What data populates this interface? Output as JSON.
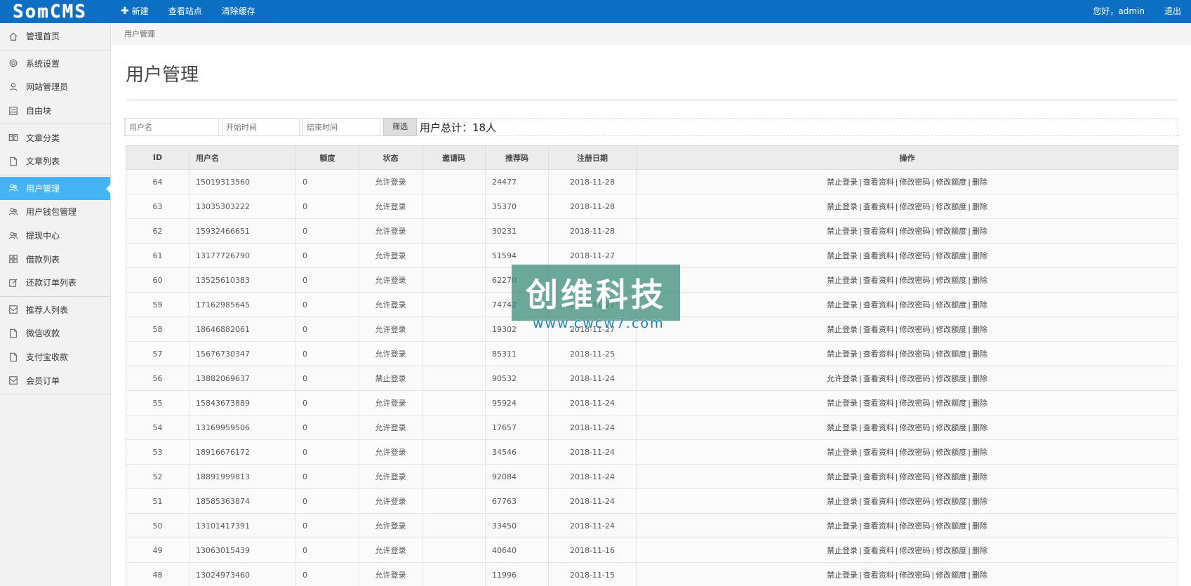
{
  "app": {
    "logo": "SomCMS"
  },
  "topnav": {
    "new_label": "新建",
    "view_site_label": "查看站点",
    "clear_cache_label": "清除缓存",
    "greeting": "您好，admin",
    "logout_label": "退出"
  },
  "sidebar": {
    "groups": [
      [
        {
          "label": "管理首页",
          "icon": "home-icon"
        }
      ],
      [
        {
          "label": "系统设置",
          "icon": "gear-icon"
        },
        {
          "label": "网站管理员",
          "icon": "user-icon"
        },
        {
          "label": "自由块",
          "icon": "block-icon"
        }
      ],
      [
        {
          "label": "文章分类",
          "icon": "book-icon"
        },
        {
          "label": "文章列表",
          "icon": "file-icon"
        }
      ],
      [
        {
          "label": "用户管理",
          "icon": "users-icon",
          "active": true
        },
        {
          "label": "用户钱包管理",
          "icon": "users-icon"
        },
        {
          "label": "提现中心",
          "icon": "users-icon"
        },
        {
          "label": "借款列表",
          "icon": "grid-icon"
        },
        {
          "label": "还款订单列表",
          "icon": "edit-icon"
        }
      ],
      [
        {
          "label": "推荐人列表",
          "icon": "inbox-icon"
        },
        {
          "label": "微信收款",
          "icon": "file-icon"
        },
        {
          "label": "支付宝收款",
          "icon": "file-icon"
        },
        {
          "label": "会员订单",
          "icon": "inbox-icon"
        }
      ]
    ]
  },
  "breadcrumb": "用户管理",
  "page_title": "用户管理",
  "filter": {
    "username_placeholder": "用户名",
    "start_placeholder": "开始时间",
    "end_placeholder": "结束时间",
    "filter_button": "筛选",
    "total_text": "用户总计：18人"
  },
  "table": {
    "headers": [
      "ID",
      "用户名",
      "额度",
      "状态",
      "邀请码",
      "推荐码",
      "注册日期",
      "操作"
    ],
    "ops_separator": "|",
    "rows": [
      {
        "id": "64",
        "username": "15019313560",
        "quota": "0",
        "status": "允许登录",
        "invite": "",
        "ref": "24477",
        "date": "2018-11-28",
        "toggle": "禁止登录"
      },
      {
        "id": "63",
        "username": "13035303222",
        "quota": "0",
        "status": "允许登录",
        "invite": "",
        "ref": "35370",
        "date": "2018-11-28",
        "toggle": "禁止登录"
      },
      {
        "id": "62",
        "username": "15932466651",
        "quota": "0",
        "status": "允许登录",
        "invite": "",
        "ref": "30231",
        "date": "2018-11-28",
        "toggle": "禁止登录"
      },
      {
        "id": "61",
        "username": "13177726790",
        "quota": "0",
        "status": "允许登录",
        "invite": "",
        "ref": "51594",
        "date": "2018-11-27",
        "toggle": "禁止登录"
      },
      {
        "id": "60",
        "username": "13525610383",
        "quota": "0",
        "status": "允许登录",
        "invite": "",
        "ref": "62270",
        "date": "",
        "toggle": "禁止登录"
      },
      {
        "id": "59",
        "username": "17162985645",
        "quota": "0",
        "status": "允许登录",
        "invite": "",
        "ref": "74742",
        "date": "2018-11-27",
        "toggle": "禁止登录"
      },
      {
        "id": "58",
        "username": "18646882061",
        "quota": "0",
        "status": "允许登录",
        "invite": "",
        "ref": "19302",
        "date": "2018-11-27",
        "toggle": "禁止登录"
      },
      {
        "id": "57",
        "username": "15676730347",
        "quota": "0",
        "status": "允许登录",
        "invite": "",
        "ref": "85311",
        "date": "2018-11-25",
        "toggle": "禁止登录"
      },
      {
        "id": "56",
        "username": "13882069637",
        "quota": "0",
        "status": "禁止登录",
        "invite": "",
        "ref": "90532",
        "date": "2018-11-24",
        "toggle": "允许登录"
      },
      {
        "id": "55",
        "username": "15843673889",
        "quota": "0",
        "status": "允许登录",
        "invite": "",
        "ref": "95924",
        "date": "2018-11-24",
        "toggle": "禁止登录"
      },
      {
        "id": "54",
        "username": "13169959506",
        "quota": "0",
        "status": "允许登录",
        "invite": "",
        "ref": "17657",
        "date": "2018-11-24",
        "toggle": "禁止登录"
      },
      {
        "id": "53",
        "username": "18916676172",
        "quota": "0",
        "status": "允许登录",
        "invite": "",
        "ref": "34546",
        "date": "2018-11-24",
        "toggle": "禁止登录"
      },
      {
        "id": "52",
        "username": "18891999813",
        "quota": "0",
        "status": "允许登录",
        "invite": "",
        "ref": "92084",
        "date": "2018-11-24",
        "toggle": "禁止登录"
      },
      {
        "id": "51",
        "username": "18585363874",
        "quota": "0",
        "status": "允许登录",
        "invite": "",
        "ref": "67763",
        "date": "2018-11-24",
        "toggle": "禁止登录"
      },
      {
        "id": "50",
        "username": "13101417391",
        "quota": "0",
        "status": "允许登录",
        "invite": "",
        "ref": "33450",
        "date": "2018-11-24",
        "toggle": "禁止登录"
      },
      {
        "id": "49",
        "username": "13063015439",
        "quota": "0",
        "status": "允许登录",
        "invite": "",
        "ref": "40640",
        "date": "2018-11-16",
        "toggle": "禁止登录"
      },
      {
        "id": "48",
        "username": "13024973460",
        "quota": "0",
        "status": "允许登录",
        "invite": "",
        "ref": "11996",
        "date": "2018-11-15",
        "toggle": "禁止登录"
      }
    ],
    "ops": {
      "view_profile": "查看资料",
      "change_password": "修改密码",
      "change_quota": "修改额度",
      "delete": "删除"
    }
  },
  "watermark": {
    "title": "创维科技",
    "url": "www.cwcw7.com"
  },
  "colors": {
    "topbar": "#0d6fc3",
    "active_sidebar": "#44b4f3",
    "sidebar_bg": "#f2f2f2"
  }
}
